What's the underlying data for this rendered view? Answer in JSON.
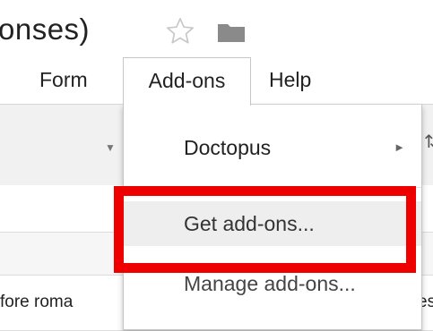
{
  "document": {
    "title": "onses)"
  },
  "menubar": {
    "items": [
      {
        "label": "Form"
      },
      {
        "label": "Add-ons"
      },
      {
        "label": "Help"
      }
    ]
  },
  "addons_menu": {
    "items": [
      {
        "label": "Doctopus",
        "has_submenu": true
      },
      {
        "label": "Get add-ons..."
      },
      {
        "label": "Manage add-ons..."
      }
    ]
  },
  "sheet": {
    "cell_text": "fore roma",
    "cell_text_right": "es"
  },
  "colors": {
    "highlight": "#ee0000",
    "toolbar_bg": "#f1f1f1",
    "star_outline": "#c8c8c8",
    "folder": "#8a8a8a"
  },
  "icons": {
    "star": "star-icon",
    "folder": "folder-icon",
    "submenu_arrow": "triangle-right-icon",
    "toolbar_dropdown": "triangle-down-icon"
  }
}
